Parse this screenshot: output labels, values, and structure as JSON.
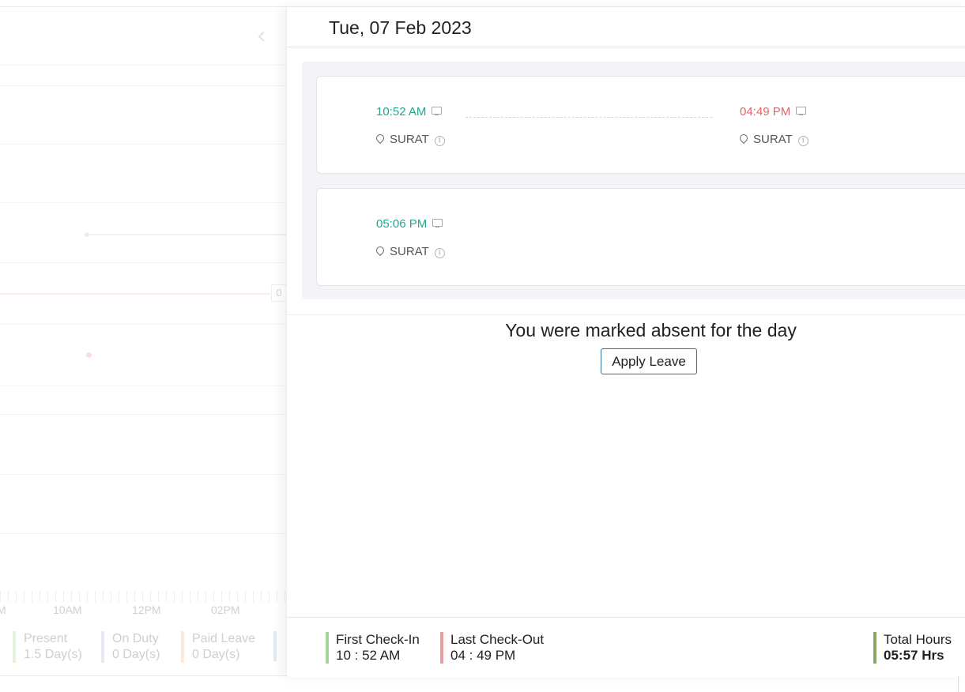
{
  "background": {
    "zero_label": "0",
    "axis_labels": [
      "M",
      "10AM",
      "12PM",
      "02PM"
    ],
    "legend": [
      {
        "label": "Present",
        "value": "1.5 Day(s)",
        "color": "#e5f2de"
      },
      {
        "label": "On Duty",
        "value": "0 Day(s)",
        "color": "#e6e8f2"
      },
      {
        "label": "Paid Leave",
        "value": "0 Day(s)",
        "color": "#fbeadb"
      }
    ]
  },
  "panel": {
    "date_title": "Tue, 07 Feb 2023",
    "sessions": [
      {
        "check_in": "10:52 AM",
        "check_in_location": "SURAT",
        "check_out": "04:49 PM",
        "check_out_location": "SURAT"
      },
      {
        "check_in": "05:06 PM",
        "check_in_location": "SURAT"
      }
    ],
    "absent_message": "You were marked absent for the day",
    "apply_leave_label": "Apply Leave",
    "summary": {
      "first_checkin_label": "First Check-In",
      "first_checkin_value": "10 : 52 AM",
      "last_checkout_label": "Last Check-Out",
      "last_checkout_value": "04 : 49 PM",
      "total_hours_label": "Total Hours",
      "total_hours_value": "05:57 Hrs"
    }
  },
  "colors": {
    "check_in": "#22a68a",
    "check_out": "#e06464",
    "first_checkin_bar": "#a5d59a",
    "last_checkout_bar": "#ef9b9b",
    "total_hours_bar": "#88a866",
    "button_border": "#2f6f9e"
  },
  "icons": [
    "chevron-left-icon",
    "desktop-icon",
    "location-pin-icon",
    "info-icon"
  ]
}
